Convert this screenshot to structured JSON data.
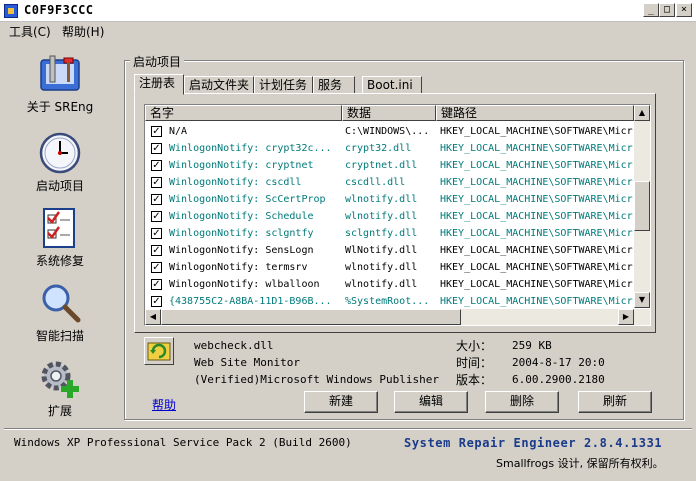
{
  "window": {
    "title": "C0F9F3CCC"
  },
  "menu": [
    {
      "label": "工具(C)"
    },
    {
      "label": "帮助(H)"
    }
  ],
  "sidebar": {
    "items": [
      {
        "label": "关于 SREng",
        "icon": "toolbox-icon"
      },
      {
        "label": "启动项目",
        "icon": "clock-icon"
      },
      {
        "label": "系统修复",
        "icon": "checklist-icon"
      },
      {
        "label": "智能扫描",
        "icon": "magnifier-icon"
      },
      {
        "label": "扩展",
        "icon": "gear-plus-icon"
      }
    ]
  },
  "group_title": "启动项目",
  "tabs": [
    {
      "label": "注册表",
      "active": true
    },
    {
      "label": "启动文件夹",
      "active": false
    },
    {
      "label": "计划任务",
      "active": false
    },
    {
      "label": "服务",
      "active": false
    },
    {
      "label": "Boot.ini",
      "active": false
    }
  ],
  "columns": [
    "名字",
    "数据",
    "键路径"
  ],
  "colors": {
    "normal": "#000000",
    "teal": "#007a7a",
    "link": "#0000cc"
  },
  "rows": [
    {
      "name": "N/A",
      "data": "C:\\WINDOWS\\...",
      "path": "HKEY_LOCAL_MACHINE\\SOFTWARE\\Micr",
      "teal": false
    },
    {
      "name": "WinlogonNotify: crypt32c...",
      "data": "crypt32.dll",
      "path": "HKEY_LOCAL_MACHINE\\SOFTWARE\\Micr",
      "teal": true
    },
    {
      "name": "WinlogonNotify: cryptnet",
      "data": "cryptnet.dll",
      "path": "HKEY_LOCAL_MACHINE\\SOFTWARE\\Micr",
      "teal": true
    },
    {
      "name": "WinlogonNotify: cscdll",
      "data": "cscdll.dll",
      "path": "HKEY_LOCAL_MACHINE\\SOFTWARE\\Micr",
      "teal": true
    },
    {
      "name": "WinlogonNotify: ScCertProp",
      "data": "wlnotify.dll",
      "path": "HKEY_LOCAL_MACHINE\\SOFTWARE\\Micr",
      "teal": true
    },
    {
      "name": "WinlogonNotify: Schedule",
      "data": "wlnotify.dll",
      "path": "HKEY_LOCAL_MACHINE\\SOFTWARE\\Micr",
      "teal": true
    },
    {
      "name": "WinlogonNotify: sclgntfy",
      "data": "sclgntfy.dll",
      "path": "HKEY_LOCAL_MACHINE\\SOFTWARE\\Micr",
      "teal": true
    },
    {
      "name": "WinlogonNotify: SensLogn",
      "data": "WlNotify.dll",
      "path": "HKEY_LOCAL_MACHINE\\SOFTWARE\\Micr",
      "teal": false
    },
    {
      "name": "WinlogonNotify: termsrv",
      "data": "wlnotify.dll",
      "path": "HKEY_LOCAL_MACHINE\\SOFTWARE\\Micr",
      "teal": false
    },
    {
      "name": "WinlogonNotify: wlballoon",
      "data": "wlnotify.dll",
      "path": "HKEY_LOCAL_MACHINE\\SOFTWARE\\Micr",
      "teal": false
    },
    {
      "name": "{438755C2-A8BA-11D1-B96B...",
      "data": "%SystemRoot...",
      "path": "HKEY_LOCAL_MACHINE\\SOFTWARE\\Micr",
      "teal": true
    }
  ],
  "details": {
    "file": "webcheck.dll",
    "description": "Web Site Monitor",
    "publisher": "(Verified)Microsoft Windows Publisher",
    "size_label": "大小：",
    "size_value": "259 KB",
    "time_label": "时间：",
    "time_value": "2004-8-17 20:0",
    "version_label": "版本：",
    "version_value": "6.00.2900.2180"
  },
  "help_link": "帮助",
  "buttons": {
    "new": "新建",
    "edit": "编辑",
    "delete": "删除",
    "refresh": "刷新"
  },
  "status": {
    "os": "Windows XP Professional Service Pack 2 (Build 2600)",
    "product": "System Repair Engineer 2.8.4.1331",
    "copyright": "Smallfrogs 设计, 保留所有权利。"
  }
}
